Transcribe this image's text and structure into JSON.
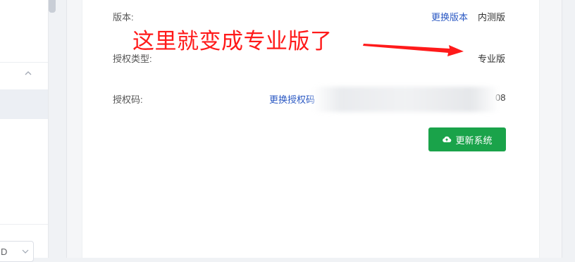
{
  "settings": {
    "version_label": "版本:",
    "change_version_link": "更换版本",
    "version_value": "内测版",
    "license_type_label": "授权类型:",
    "license_type_value": "专业版",
    "license_code_label": "授权码:",
    "change_license_link": "更换授权码",
    "license_code_tail": "08",
    "update_button_label": "更新系统"
  },
  "annotation": {
    "text": "这里就变成专业版了",
    "color": "#ff1a1a"
  },
  "sidebar": {
    "select_value": "D"
  },
  "colors": {
    "accent_link": "#2b59c3",
    "primary_button": "#1aa34a"
  },
  "icons": {
    "update_button_icon": "cloud-upload-icon",
    "sidebar_collapse_icon": "chevron-up-icon",
    "select_arrow_icon": "chevron-down-icon"
  }
}
